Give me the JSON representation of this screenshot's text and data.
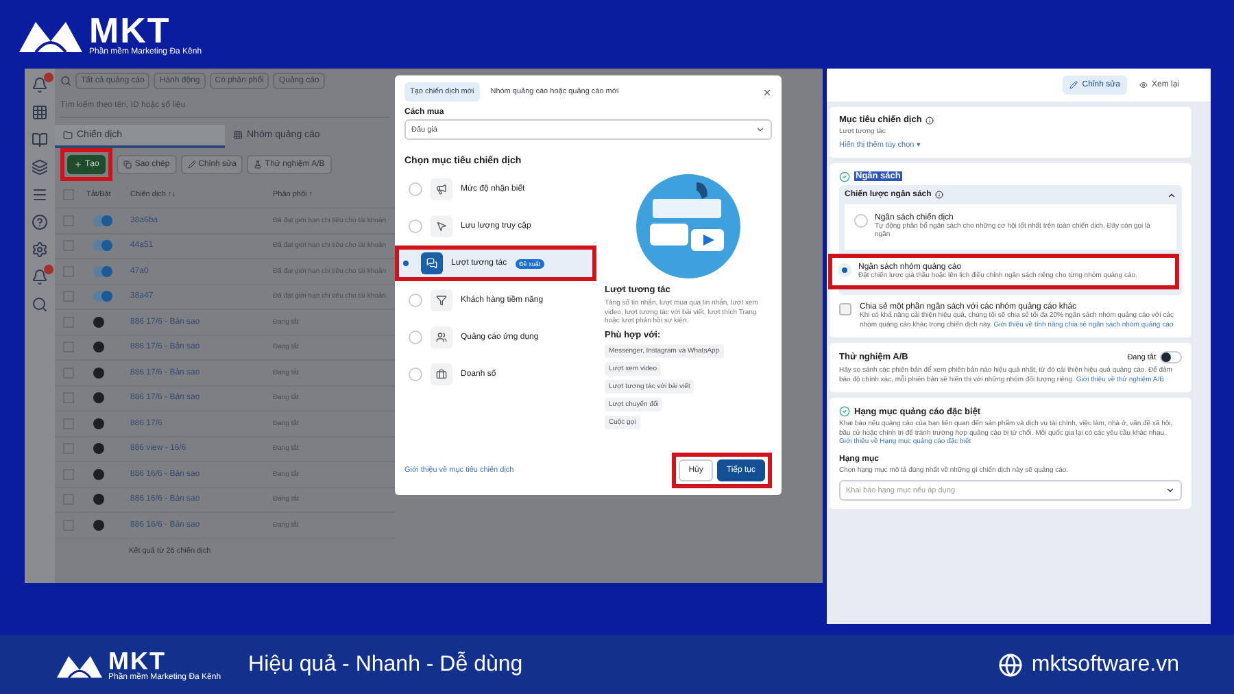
{
  "brand": {
    "name": "MKT",
    "tagline": "Phần mềm Marketing Đa Kênh"
  },
  "footer_brand": {
    "name": "MKT",
    "tagline": "Phần mềm Marketing Đa Kênh"
  },
  "header_checked": false,
  "ads_manager": {
    "filters": [
      "Tất cả quảng cáo",
      "Hành động",
      "Có phân phối",
      "Quảng cáo"
    ],
    "search": {
      "placeholder": "Tìm kiếm theo tên, ID hoặc số liệu"
    },
    "tabs": [
      {
        "label": "Chiến dịch",
        "selected": true
      },
      {
        "label": "Nhóm quảng cáo",
        "selected": false
      }
    ],
    "actions": [
      {
        "label": "Tạo",
        "kind": "create",
        "highlighted": true
      },
      {
        "label": "Sao chép",
        "kind": "copy",
        "highlighted": false
      },
      {
        "label": "Chỉnh sửa",
        "kind": "edit",
        "highlighted": false
      },
      {
        "label": "Thử nghiệm A/B",
        "kind": "test",
        "highlighted": false
      }
    ],
    "columns": [
      "Tắt/Bật",
      "Chiến dịch ↑↓",
      "Phân phối ↑"
    ],
    "rows": [
      {
        "checked": false,
        "on": true,
        "name": "38a6ba",
        "delivery": "Đã đạt giới hạn chi tiêu cho tài khoản"
      },
      {
        "checked": false,
        "on": true,
        "name": "44a51",
        "delivery": "Đã đạt giới hạn chi tiêu cho tài khoản"
      },
      {
        "checked": false,
        "on": true,
        "name": "47a0",
        "delivery": "Đã đạt giới hạn chi tiêu cho tài khoản"
      },
      {
        "checked": false,
        "on": true,
        "name": "38a47",
        "delivery": "Đã đạt giới hạn chi tiêu cho tài khoản"
      },
      {
        "checked": false,
        "on": false,
        "name": "886 17/6 - Bản sao",
        "delivery": "Đang tắt"
      },
      {
        "checked": false,
        "on": false,
        "name": "886 17/6 - Bản sao",
        "delivery": "Đang tắt"
      },
      {
        "checked": false,
        "on": false,
        "name": "886 17/6 - Bản sao",
        "delivery": "Đang tắt"
      },
      {
        "checked": false,
        "on": false,
        "name": "886 17/6 - Bản sao",
        "delivery": "Đang tắt"
      },
      {
        "checked": false,
        "on": false,
        "name": "886 17/6",
        "delivery": "Đang tắt"
      },
      {
        "checked": false,
        "on": false,
        "name": "886 view - 16/6",
        "delivery": "Đang tắt"
      },
      {
        "checked": false,
        "on": false,
        "name": "886 16/6 - Bản sao",
        "delivery": "Đang tắt"
      },
      {
        "checked": false,
        "on": false,
        "name": "886 16/6 - Bản sao",
        "delivery": "Đang tắt"
      },
      {
        "checked": false,
        "on": false,
        "name": "886 16/6 - Bản sao",
        "delivery": "Đang tắt"
      }
    ],
    "summary": "Kết quả từ 26 chiến dịch"
  },
  "modal": {
    "tabs": [
      {
        "label": "Tạo chiến dịch mới",
        "selected": true
      },
      {
        "label": "Nhóm quảng cáo hoặc quảng cáo mới",
        "selected": false
      }
    ],
    "buying_type": {
      "label": "Cách mua",
      "value": "Đấu giá"
    },
    "objective_heading": "Chọn mục tiêu chiến dịch",
    "objectives": [
      {
        "label": "Mức độ nhận biết",
        "selected": false,
        "highlighted": false
      },
      {
        "label": "Lưu lượng truy cập",
        "selected": false,
        "highlighted": false
      },
      {
        "label": "Lượt tương tác",
        "selected": true,
        "highlighted": true,
        "badge": "Đề xuất"
      },
      {
        "label": "Khách hàng tiềm năng",
        "selected": false,
        "highlighted": false
      },
      {
        "label": "Quảng cáo ứng dụng",
        "selected": false,
        "highlighted": false
      },
      {
        "label": "Doanh số",
        "selected": false,
        "highlighted": false
      }
    ],
    "detail": {
      "title": "Lượt tương tác",
      "description": "Tăng số tin nhắn, lượt mua qua tin nhắn, lượt xem video, lượt tương tác với bài viết, lượt thích Trang hoặc lượt phản hồi sự kiện.",
      "fit_label": "Phù hợp với:",
      "fits": [
        "Messenger, Instagram và WhatsApp",
        "Lượt xem video",
        "Lượt tương tác với bài viết",
        "Lượt chuyển đổi",
        "Cuộc gọi"
      ]
    },
    "link": "Giới thiệu về mục tiêu chiến dịch",
    "buttons": [
      {
        "label": "Hủy",
        "kind": "secondary"
      },
      {
        "label": "Tiếp tục",
        "kind": "primary"
      }
    ],
    "buttons_highlighted": true
  },
  "campaign_editor": {
    "toolbar": [
      {
        "label": "Chỉnh sửa",
        "selected": true
      },
      {
        "label": "Xem lại",
        "selected": false
      }
    ],
    "objective": {
      "title": "Mục tiêu chiến dịch",
      "value": "Lượt tương tác",
      "more": "Hiển thị thêm tùy chọn ▾"
    },
    "budget": {
      "title": "Ngân sách",
      "strategy": "Chiến lược ngân sách",
      "options": [
        {
          "label": "Ngân sách chiến dịch",
          "description": "Tự động phân bổ ngân sách cho những cơ hội tốt nhất trên toàn chiến dịch. Đây còn gọi là ngân",
          "selected": false,
          "highlighted": false
        },
        {
          "label": "Ngân sách nhóm quảng cáo",
          "description": "Đặt chiến lược giá thầu hoặc lên lịch điều chỉnh ngân sách riêng cho từng nhóm quảng cáo.",
          "selected": true,
          "highlighted": true
        }
      ],
      "share": {
        "label": "Chia sẻ một phần ngân sách với các nhóm quảng cáo khác",
        "description": "Khi có khả năng cải thiện hiệu quả, chúng tôi sẽ chia sẻ tối đa 20% ngân sách nhóm quảng cáo với các nhóm quảng cáo khác trong chiến dịch này.",
        "link": "Giới thiệu về tính năng chia sẻ ngân sách nhóm quảng cáo",
        "checked": false
      }
    },
    "ab_test": {
      "title": "Thử nghiệm A/B",
      "status": "Đang tắt",
      "on": false,
      "description": "Hãy so sánh các phiên bản để xem phiên bản nào hiệu quả nhất, từ đó cải thiện hiệu quả quảng cáo. Để đảm bảo độ chính xác, mỗi phiên bản sẽ hiển thị với những nhóm đối tượng riêng.",
      "link": "Giới thiệu về thử nghiệm A/B"
    },
    "special": {
      "title": "Hạng mục quảng cáo đặc biệt",
      "description": "Khai báo nếu quảng cáo của bạn liên quan đến sản phẩm và dịch vụ tài chính, việc làm, nhà ở, vấn đề xã hội, bầu cử hoặc chính trị để tránh trường hợp quảng cáo bị từ chối. Mỗi quốc gia lại có các yêu cầu khác nhau.",
      "link": "Giới thiệu về Hạng mục quảng cáo đặc biệt",
      "field_label": "Hạng mục",
      "field_hint": "Chọn hạng mục mô tả đúng nhất về những gì chiến dịch này sẽ quảng cáo.",
      "placeholder": "Khai báo hạng mục nếu áp dụng"
    }
  },
  "footer": {
    "slogan": "Hiệu quả - Nhanh - Dễ dùng",
    "website": "mktsoftware.vn"
  }
}
